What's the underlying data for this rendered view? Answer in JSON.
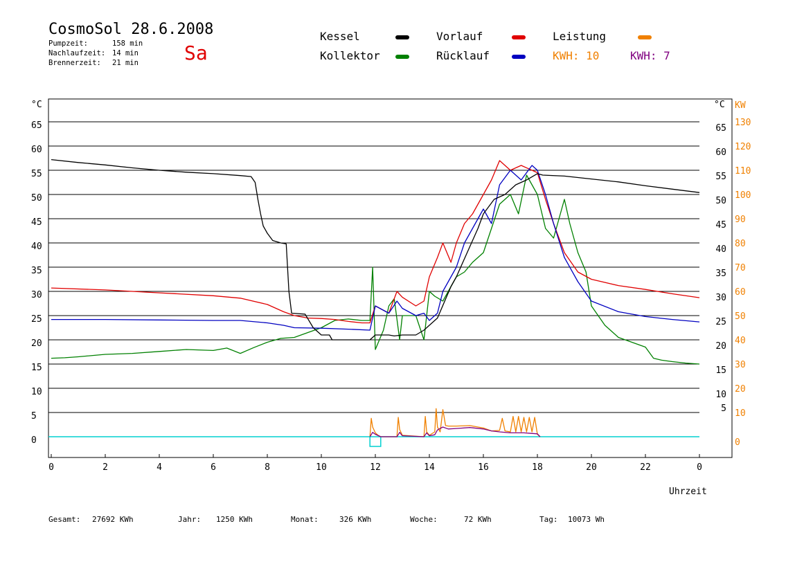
{
  "header": {
    "title": "CosmoSol 28.6.2008",
    "day": "Sa",
    "stats": [
      {
        "label": "Pumpzeit:",
        "value": "158 min"
      },
      {
        "label": "Nachlaufzeit:",
        "value": "14 min"
      },
      {
        "label": "Brennerzeit:",
        "value": "21 min"
      }
    ]
  },
  "legend": {
    "kessel": "Kessel",
    "kollektor": "Kollektor",
    "vorlauf": "Vorlauf",
    "ruecklauf": "Rücklauf",
    "leistung": "Leistung",
    "kwh1": "KWH: 10",
    "kwh2": "KWH: 7"
  },
  "colors": {
    "kessel": "#000000",
    "kollektor": "#008000",
    "vorlauf": "#e00000",
    "ruecklauf": "#0000c0",
    "leistung": "#f08000",
    "kwh2": "#800080",
    "zero_line": "#00d0d0"
  },
  "footer": {
    "gesamt_label": "Gesamt:",
    "gesamt_value": "27692 KWh",
    "jahr_label": "Jahr:",
    "jahr_value": "1250 KWh",
    "monat_label": "Monat:",
    "monat_value": "326 KWh",
    "woche_label": "Woche:",
    "woche_value": "72 KWh",
    "tag_label": "Tag:",
    "tag_value": "10073 Wh"
  },
  "chart_data": {
    "type": "line",
    "xlabel": "Uhrzeit",
    "ylabel_left": "°C",
    "ylabel_right": "°C",
    "ylabel_kw": "KW",
    "xlim": [
      0,
      24
    ],
    "ylim": [
      -4,
      69
    ],
    "x_ticks": [
      "0",
      "2",
      "4",
      "6",
      "8",
      "10",
      "12",
      "14",
      "16",
      "18",
      "20",
      "22",
      "0"
    ],
    "y_ticks": [
      0,
      5,
      10,
      15,
      20,
      25,
      30,
      35,
      40,
      45,
      50,
      55,
      60,
      65
    ],
    "right_c_ticks": [
      5,
      10,
      15,
      20,
      25,
      30,
      35,
      40,
      45,
      50,
      55,
      60,
      65
    ],
    "right_kw_ticks": [
      0,
      10,
      20,
      30,
      40,
      50,
      60,
      70,
      80,
      90,
      100,
      110,
      120,
      130
    ],
    "kw_scale": "kw = 2 x °C",
    "grid": "horizontal",
    "series": [
      {
        "name": "Kessel",
        "key": "kessel",
        "x": [
          0,
          1,
          2,
          3,
          4,
          5,
          6,
          7,
          7.4,
          7.55,
          7.65,
          7.75,
          7.85,
          8.0,
          8.2,
          8.5,
          8.7,
          8.8,
          8.9,
          9.4,
          9.7,
          10,
          10.3,
          10.4,
          11,
          11.8,
          12,
          12.5,
          12.7,
          13,
          13.5,
          13.8,
          14,
          14.3,
          14.8,
          15,
          15.4,
          15.8,
          16,
          16.4,
          16.8,
          17.2,
          17.6,
          18,
          18.2,
          19,
          20,
          21,
          22,
          23,
          24
        ],
        "y": [
          57.2,
          56.6,
          56.1,
          55.5,
          55,
          54.6,
          54.3,
          53.9,
          53.7,
          52.5,
          49,
          46,
          43.5,
          42,
          40.5,
          40,
          39.8,
          30,
          25.5,
          25.3,
          22.5,
          21,
          21,
          20,
          20,
          20,
          21,
          21,
          20.8,
          21,
          21,
          22,
          23,
          24.5,
          31,
          33,
          38,
          43,
          46,
          49,
          50,
          52,
          53,
          54.3,
          54,
          53.8,
          53.2,
          52.6,
          51.8,
          51.1,
          50.4
        ]
      },
      {
        "name": "Vorlauf",
        "key": "vorlauf",
        "x": [
          0,
          2,
          4,
          6,
          7,
          8,
          8.6,
          9,
          9.5,
          10,
          10.5,
          11,
          11.5,
          11.8,
          12,
          12.5,
          12.8,
          13,
          13.5,
          13.8,
          14,
          14.3,
          14.5,
          14.8,
          15,
          15.3,
          15.6,
          16,
          16.3,
          16.6,
          17,
          17.4,
          17.8,
          18,
          18.3,
          18.6,
          19,
          19.5,
          20,
          21,
          22,
          23,
          24
        ],
        "y": [
          30.7,
          30.3,
          29.7,
          29.1,
          28.6,
          27.3,
          25.8,
          25,
          24.5,
          24.4,
          24.2,
          23.8,
          23.5,
          23.5,
          27,
          25.5,
          30,
          28.8,
          27,
          28,
          33,
          37,
          40,
          36,
          40,
          44,
          46,
          50,
          53,
          57,
          55,
          56,
          55,
          54.5,
          49,
          44,
          38,
          34,
          32.5,
          31.2,
          30.4,
          29.5,
          28.7
        ]
      },
      {
        "name": "Rücklauf",
        "key": "ruecklauf",
        "x": [
          0,
          2,
          4,
          6,
          7,
          8,
          8.6,
          9,
          10,
          11,
          11.8,
          12,
          12.5,
          12.8,
          13,
          13.5,
          13.8,
          14,
          14.3,
          14.5,
          14.8,
          15,
          15.3,
          15.6,
          16,
          16.3,
          16.6,
          17,
          17.4,
          17.8,
          18,
          18.3,
          18.6,
          19,
          19.5,
          20,
          21,
          22,
          23,
          24
        ],
        "y": [
          24.2,
          24.2,
          24.1,
          24,
          24,
          23.5,
          23,
          22.5,
          22.4,
          22.2,
          22,
          27,
          25.5,
          28,
          26.5,
          25,
          25.5,
          24,
          25.5,
          30,
          33,
          35,
          40,
          43,
          47,
          44,
          52,
          55,
          53,
          56,
          55,
          50,
          44,
          37,
          32,
          28,
          25.8,
          24.8,
          24.2,
          23.7
        ]
      },
      {
        "name": "Kollektor",
        "key": "kollektor",
        "x": [
          0,
          0.5,
          1,
          2,
          3,
          4,
          5,
          6,
          6.5,
          7,
          7.5,
          8,
          8.5,
          9,
          9.5,
          10,
          10.5,
          11,
          11.5,
          11.8,
          11.9,
          12,
          12.3,
          12.5,
          12.7,
          12.9,
          13,
          13.5,
          13.8,
          14,
          14.2,
          14.5,
          14.8,
          15,
          15.3,
          15.6,
          16,
          16.3,
          16.6,
          17,
          17.3,
          17.6,
          18,
          18.3,
          18.6,
          19,
          19.2,
          19.5,
          19.8,
          20,
          20.5,
          21,
          21.5,
          22,
          22.3,
          22.6,
          23,
          23.5,
          24
        ],
        "y": [
          16.2,
          16.3,
          16.5,
          17,
          17.2,
          17.6,
          18,
          17.8,
          18.3,
          17.2,
          18.4,
          19.5,
          20.3,
          20.5,
          21.5,
          22.5,
          24,
          24.3,
          24,
          24,
          35,
          18,
          22,
          27,
          28.5,
          20,
          25,
          25,
          20,
          30,
          29,
          28,
          31,
          33,
          34,
          36,
          38,
          43,
          48,
          50,
          46,
          54,
          50,
          43,
          41,
          49,
          44,
          38,
          34,
          27,
          23,
          20.5,
          19.5,
          18.5,
          16.2,
          15.8,
          15.5,
          15.2,
          15
        ]
      },
      {
        "name": "Leistung",
        "key": "leistung",
        "x": [
          11.8,
          11.85,
          11.9,
          12,
          12.1,
          12.2,
          12.8,
          12.85,
          12.9,
          13,
          13.8,
          13.85,
          13.9,
          14,
          14.2,
          14.25,
          14.3,
          14.4,
          14.5,
          14.6,
          14.7,
          15,
          15.5,
          16,
          16.3,
          16.6,
          16.7,
          16.8,
          17,
          17.1,
          17.2,
          17.3,
          17.4,
          17.5,
          17.6,
          17.7,
          17.8,
          17.9,
          18.0,
          18.1
        ],
        "y": [
          0,
          3.8,
          2,
          0.8,
          0.3,
          0,
          0,
          4,
          1.5,
          0.3,
          0,
          4.2,
          1,
          0.3,
          1,
          5.8,
          2,
          1,
          5.6,
          2.3,
          2.2,
          2.2,
          2.3,
          1.8,
          1.2,
          1.3,
          3.8,
          1.2,
          1,
          4.2,
          1,
          4.2,
          1,
          4,
          1,
          4,
          1,
          4,
          0.5,
          0
        ]
      },
      {
        "name": "KWH: 7",
        "key": "kwh2",
        "x": [
          11.8,
          11.9,
          12,
          12.2,
          12.8,
          12.9,
          13,
          13.8,
          13.9,
          14,
          14.2,
          14.3,
          14.5,
          14.7,
          15,
          15.5,
          16,
          16.3,
          16.6,
          17,
          17.5,
          18,
          18.1
        ],
        "y": [
          0,
          0.9,
          0.5,
          0,
          0,
          0.9,
          0.2,
          0,
          0.8,
          0.2,
          0.4,
          1.4,
          2,
          1.6,
          1.7,
          1.9,
          1.6,
          1.2,
          1.0,
          0.8,
          0.8,
          0.6,
          0
        ]
      }
    ]
  }
}
